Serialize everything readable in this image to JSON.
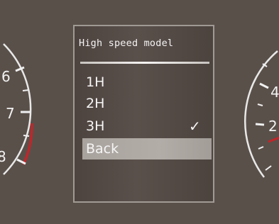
{
  "left_gauge": {
    "ticks": [
      "6",
      "7",
      "8"
    ]
  },
  "right_gauge": {
    "ticks": [
      "4",
      "2"
    ]
  },
  "menu": {
    "title": "High speed model",
    "items": [
      {
        "label": "1H",
        "checked": false,
        "selected": false
      },
      {
        "label": "2H",
        "checked": false,
        "selected": false
      },
      {
        "label": "3H",
        "checked": true,
        "selected": false
      },
      {
        "label": "Back",
        "checked": false,
        "selected": true
      }
    ],
    "check_mark": "✓"
  },
  "colors": {
    "background": "#5a504a",
    "redline": "#c0262a",
    "selection": "#aea8a3"
  }
}
